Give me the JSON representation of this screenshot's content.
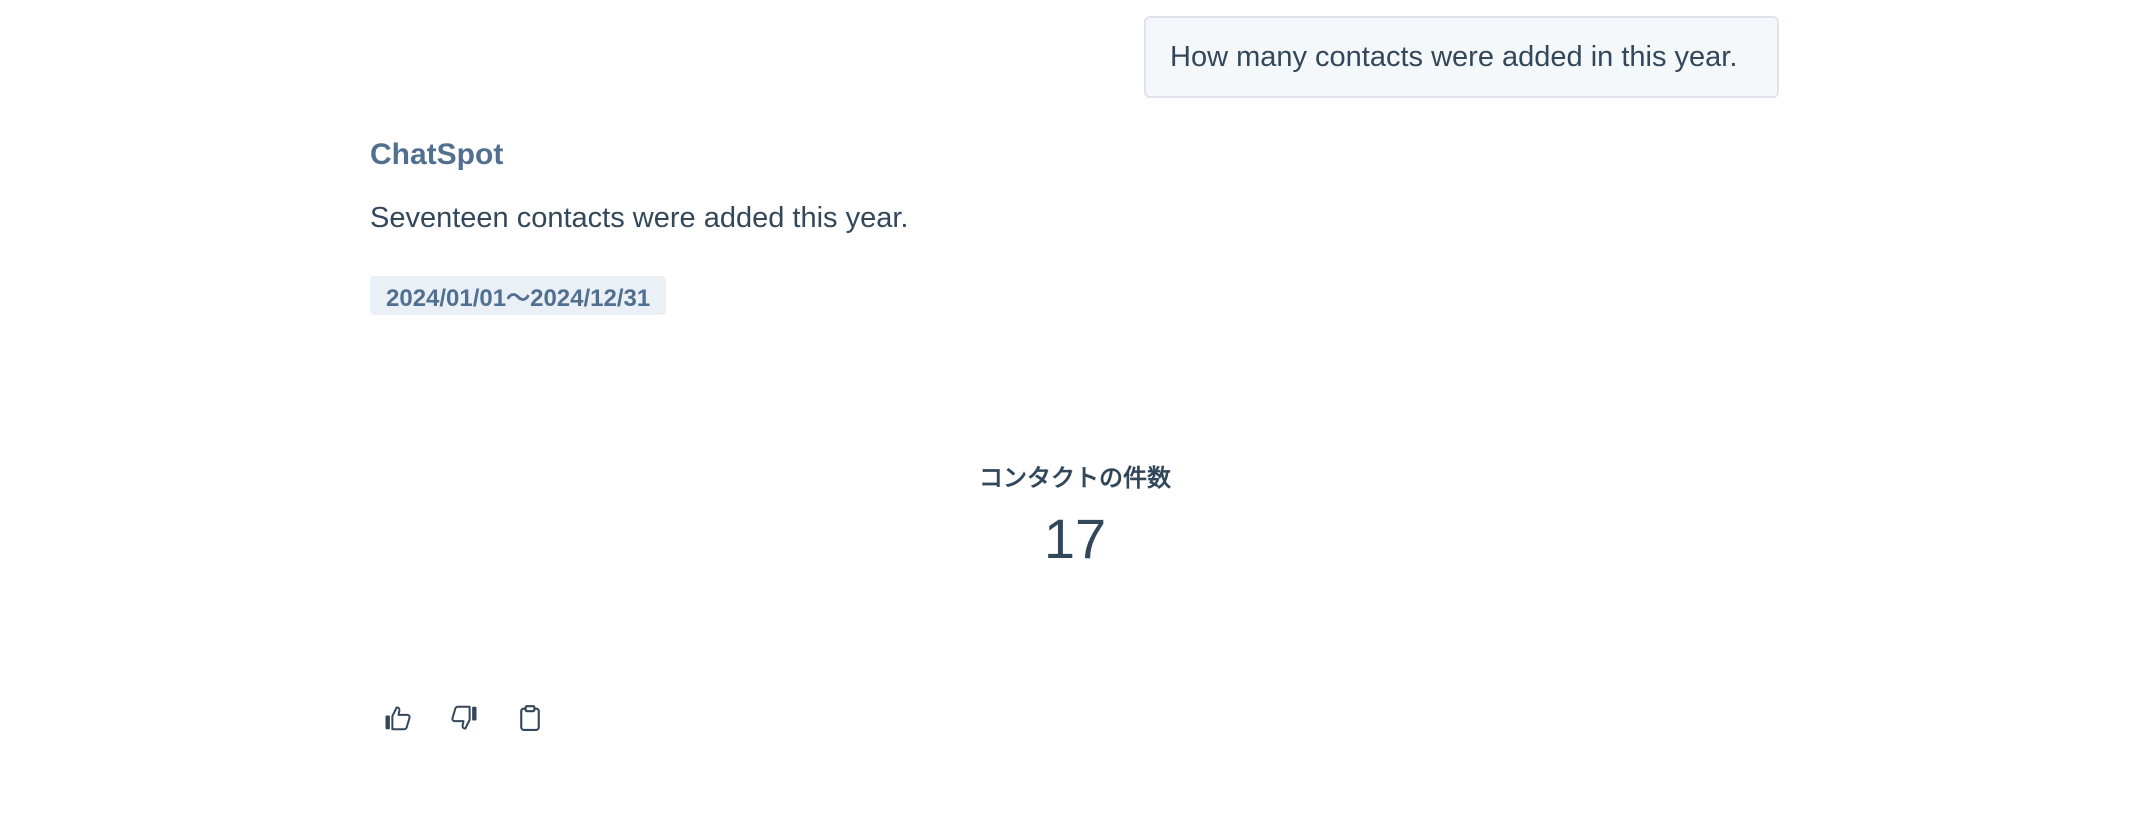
{
  "user_message": {
    "text": "How many contacts were added in this year."
  },
  "response": {
    "sender": "ChatSpot",
    "answer": "Seventeen contacts were added this year.",
    "date_range": "2024/01/01〜2024/12/31",
    "metric": {
      "label": "コンタクトの件数",
      "value": "17"
    }
  },
  "actions": {
    "icons": [
      "thumbs-up-icon",
      "thumbs-down-icon",
      "clipboard-icon"
    ]
  },
  "colors": {
    "text_primary": "#33475b",
    "text_secondary": "#516f90",
    "bubble_bg": "#f5f8fa",
    "bubble_border": "#dfe3eb",
    "badge_bg": "#eaf0f6"
  }
}
